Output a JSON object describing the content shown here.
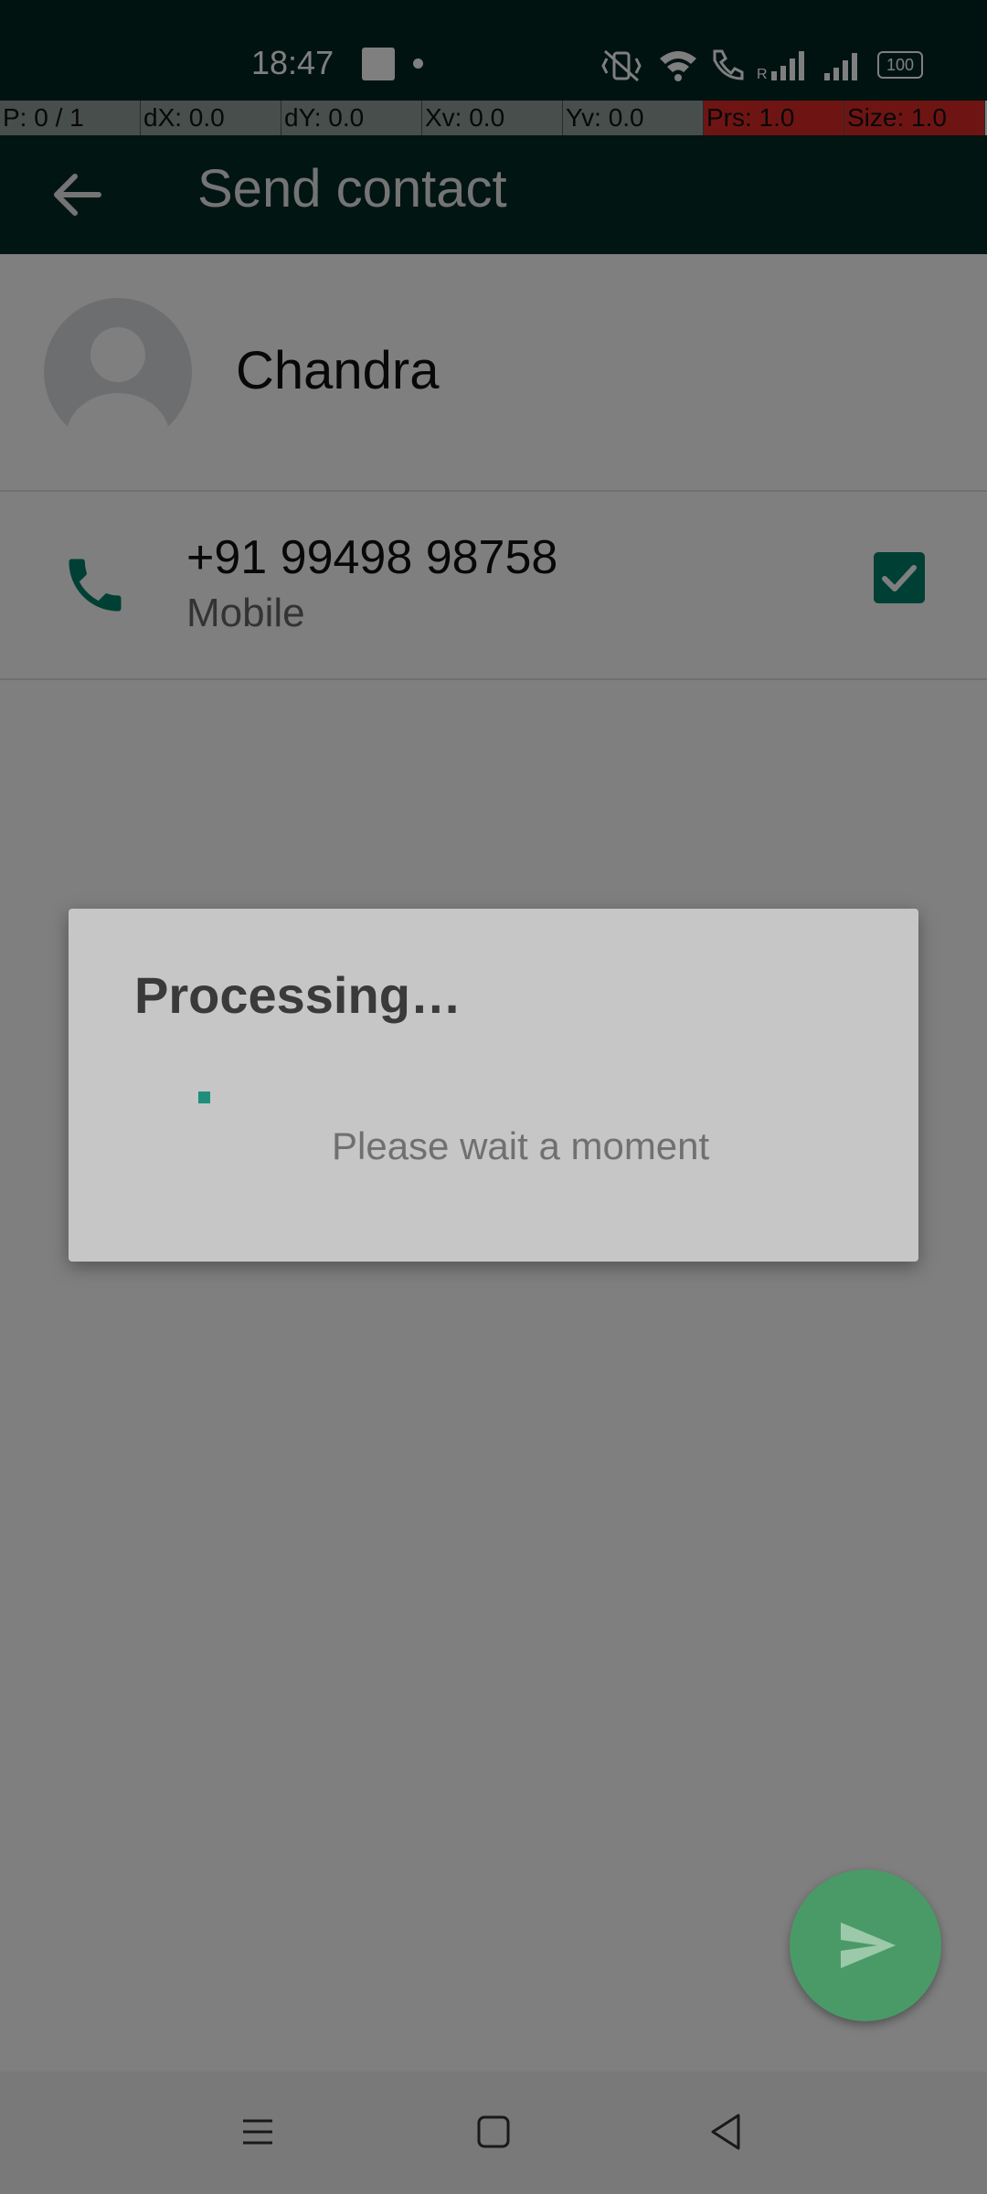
{
  "status_bar": {
    "time": "18:47",
    "battery": "100"
  },
  "debug_bar": {
    "cells": [
      "P: 0 / 1",
      "dX: 0.0",
      "dY: 0.0",
      "Xv: 0.0",
      "Yv: 0.0",
      "Prs: 1.0",
      "Size: 1.0"
    ]
  },
  "app_bar": {
    "title": "Send contact",
    "back_icon": "arrow-back-icon"
  },
  "contact": {
    "name": "Chandra",
    "phone_number": "+91 99498 98758",
    "phone_type": "Mobile",
    "phone_checked": true
  },
  "dialog": {
    "title": "Processing…",
    "message": "Please wait a moment"
  },
  "fab": {
    "icon": "send-icon"
  },
  "colors": {
    "accent": "#008069",
    "header": "#022a26"
  }
}
